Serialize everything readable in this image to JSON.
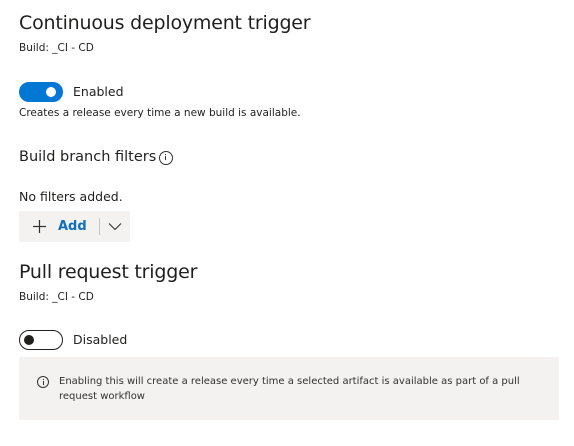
{
  "cd_trigger": {
    "title": "Continuous deployment trigger",
    "build_label": "Build: _CI - CD",
    "toggle_state_label": "Enabled",
    "description": "Creates a release every time a new build is available.",
    "branch_filters_heading": "Build branch filters",
    "no_filters_text": "No filters added.",
    "add_button_label": "Add"
  },
  "pr_trigger": {
    "title": "Pull request trigger",
    "build_label": "Build: _CI - CD",
    "toggle_state_label": "Disabled",
    "info_text": "Enabling this will create a release every time a selected artifact is available as part of a pull request workflow"
  },
  "toggles": {
    "cd_enabled": true,
    "pr_enabled": false
  },
  "colors": {
    "accent": "#0078d4",
    "link": "#106ebe",
    "panel_background": "#f3f2f1"
  },
  "icons": [
    "info-icon",
    "plus-icon",
    "chevron-down-icon"
  ]
}
